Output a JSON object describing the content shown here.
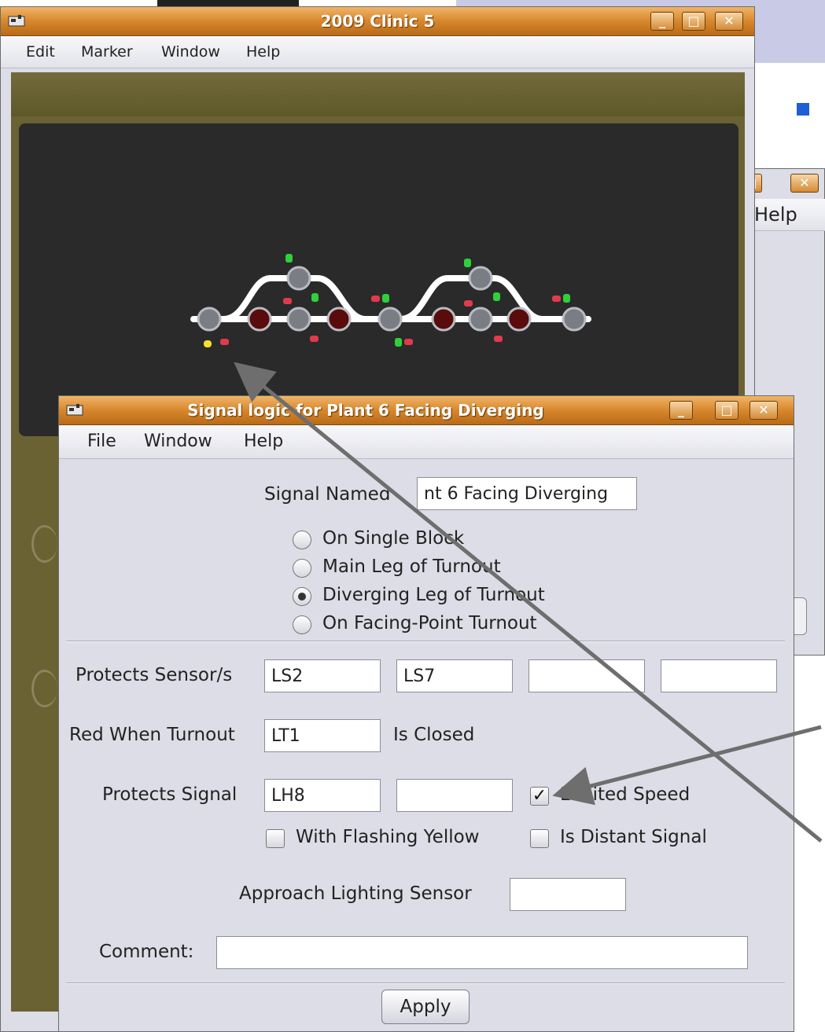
{
  "back_window": {
    "title": "2009 Clinic 5",
    "menu": [
      "Edit",
      "Marker",
      "Window",
      "Help"
    ]
  },
  "third_window": {
    "menu_fragment": "Help"
  },
  "dialog": {
    "title": "Signal logic for Plant 6 Facing Diverging",
    "menu": [
      "File",
      "Window",
      "Help"
    ],
    "signal_named_label": "Signal Named",
    "signal_named_value": "nt 6 Facing Diverging",
    "radio_options": [
      {
        "label": "On Single Block",
        "selected": false
      },
      {
        "label": "Main Leg of Turnout",
        "selected": false
      },
      {
        "label": "Diverging Leg of Turnout",
        "selected": true
      },
      {
        "label": "On Facing-Point Turnout",
        "selected": false
      }
    ],
    "protects_sensors_label": "Protects Sensor/s",
    "protects_sensors": [
      "LS2",
      "LS7",
      "",
      ""
    ],
    "red_when_turnout_label": "Red When Turnout",
    "red_when_turnout_value": "LT1",
    "is_closed_label": "Is Closed",
    "protects_signal_label": "Protects Signal",
    "protects_signals": [
      "LH8",
      ""
    ],
    "limited_speed_label": "Limited Speed",
    "limited_speed_checked": true,
    "with_flashing_yellow_label": "With Flashing Yellow",
    "with_flashing_yellow_checked": false,
    "is_distant_signal_label": "Is Distant Signal",
    "is_distant_signal_checked": false,
    "approach_lighting_label": "Approach Lighting Sensor",
    "approach_lighting_value": "",
    "comment_label": "Comment:",
    "comment_value": "",
    "apply_label": "Apply"
  },
  "colors": {
    "titlebar": "#d7872c",
    "window_bg": "#dcdde6",
    "track": "#ffffff",
    "annotation_arrow": "#6e6e6e",
    "signal_green": "#2fd03a",
    "signal_red": "#e23a4d",
    "signal_yellow": "#f4e22a"
  }
}
